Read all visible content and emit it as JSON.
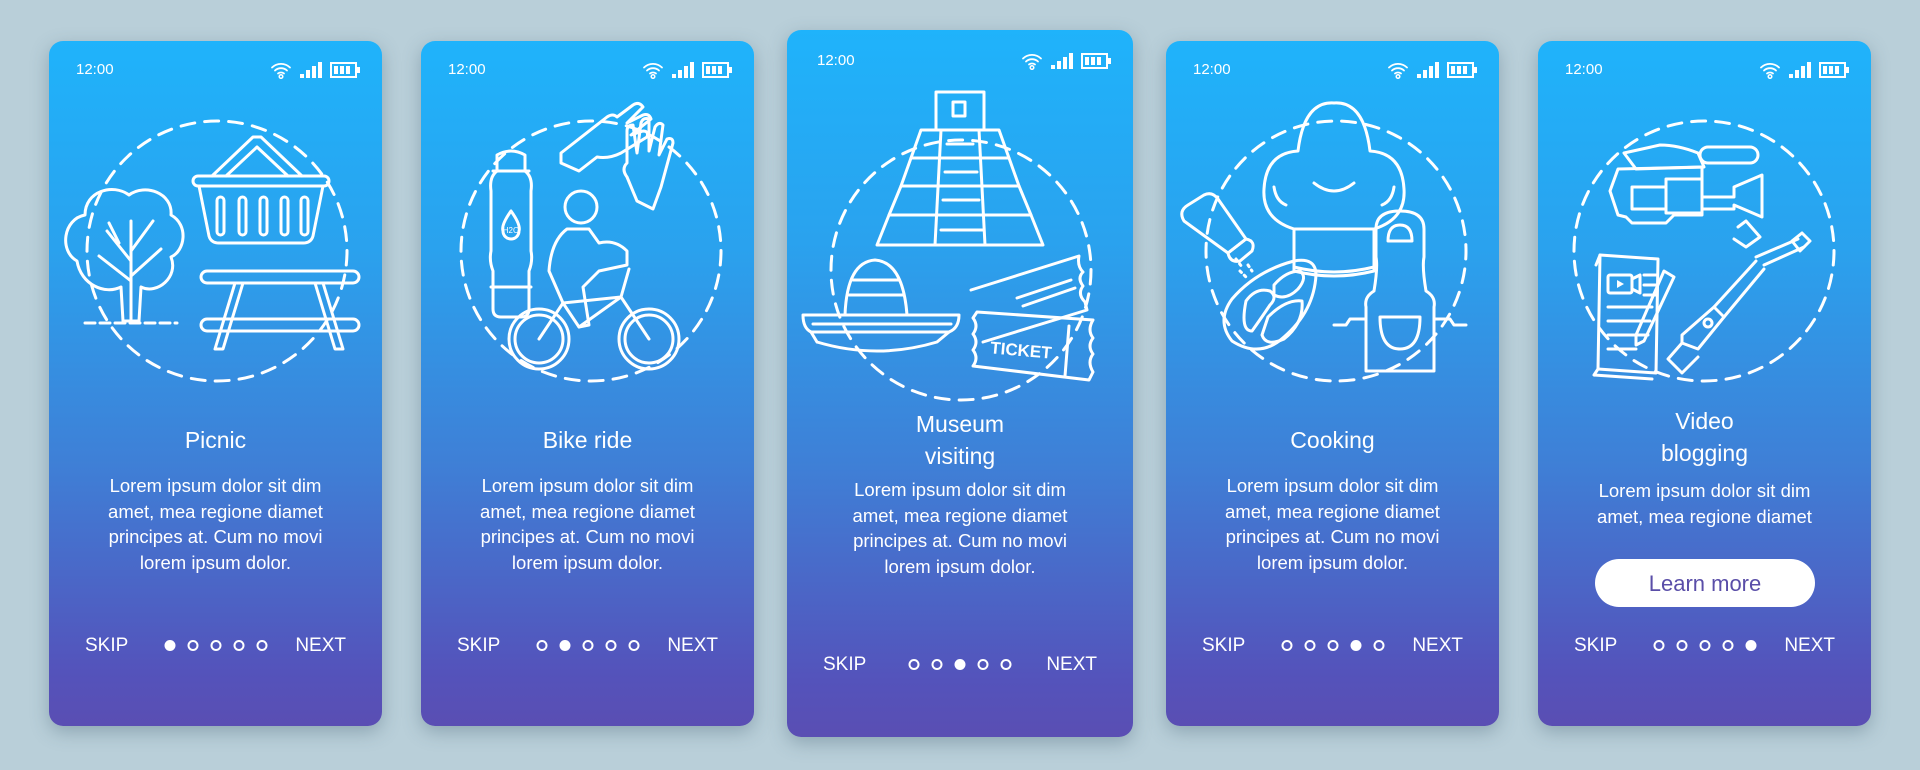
{
  "status_bar": {
    "time": "12:00",
    "icons": [
      "wifi-icon",
      "signal-icon",
      "battery-icon"
    ]
  },
  "colors": {
    "background": "#b9cfd9",
    "gradient_top": "#1fb3fb",
    "gradient_bottom": "#5a4eb3",
    "text": "#ffffff",
    "button_text": "#5a4ea8"
  },
  "screens": [
    {
      "id": "picnic",
      "title_lines": [
        "Picnic"
      ],
      "body_lines": [
        "Lorem ipsum dolor sit dim",
        "amet, mea regione diamet",
        "principes at. Cum no movi",
        "lorem ipsum dolor."
      ],
      "illustration": [
        "tree-icon",
        "picnic-basket-icon",
        "picnic-table-icon"
      ],
      "skip_label": "SKIP",
      "next_label": "NEXT",
      "active_page": 1,
      "page_count": 5
    },
    {
      "id": "bike-ride",
      "title_lines": [
        "Bike ride"
      ],
      "body_lines": [
        "Lorem ipsum dolor sit dim",
        "amet, mea regione diamet",
        "principes at. Cum no movi",
        "lorem ipsum dolor."
      ],
      "illustration": [
        "water-bottle-icon",
        "gloves-icon",
        "cyclist-icon"
      ],
      "bottle_label": "H2O",
      "skip_label": "SKIP",
      "next_label": "NEXT",
      "active_page": 2,
      "page_count": 5
    },
    {
      "id": "museum-visiting",
      "title_lines": [
        "Museum",
        "visiting"
      ],
      "body_lines": [
        "Lorem ipsum dolor sit dim",
        "amet, mea regione diamet",
        "principes at. Cum no movi",
        "lorem ipsum dolor."
      ],
      "illustration": [
        "pyramid-icon",
        "sombrero-icon",
        "tickets-icon"
      ],
      "ticket_label": "TICKET",
      "skip_label": "SKIP",
      "next_label": "NEXT",
      "active_page": 3,
      "page_count": 5
    },
    {
      "id": "cooking",
      "title_lines": [
        "Cooking"
      ],
      "body_lines": [
        "Lorem ipsum dolor sit dim",
        "amet, mea regione diamet",
        "principes at. Cum no movi",
        "lorem ipsum dolor."
      ],
      "illustration": [
        "chef-hat-icon",
        "salt-shaker-icon",
        "steak-icon",
        "apron-icon"
      ],
      "skip_label": "SKIP",
      "next_label": "NEXT",
      "active_page": 4,
      "page_count": 5
    },
    {
      "id": "video-blogging",
      "title_lines": [
        "Video",
        "blogging"
      ],
      "body_lines": [
        "Lorem ipsum dolor sit dim",
        "amet, mea regione diamet"
      ],
      "illustration": [
        "video-camera-icon",
        "script-document-icon",
        "selfie-stick-icon"
      ],
      "button_label": "Learn more",
      "skip_label": "SKIP",
      "next_label": "NEXT",
      "active_page": 5,
      "page_count": 5
    }
  ]
}
